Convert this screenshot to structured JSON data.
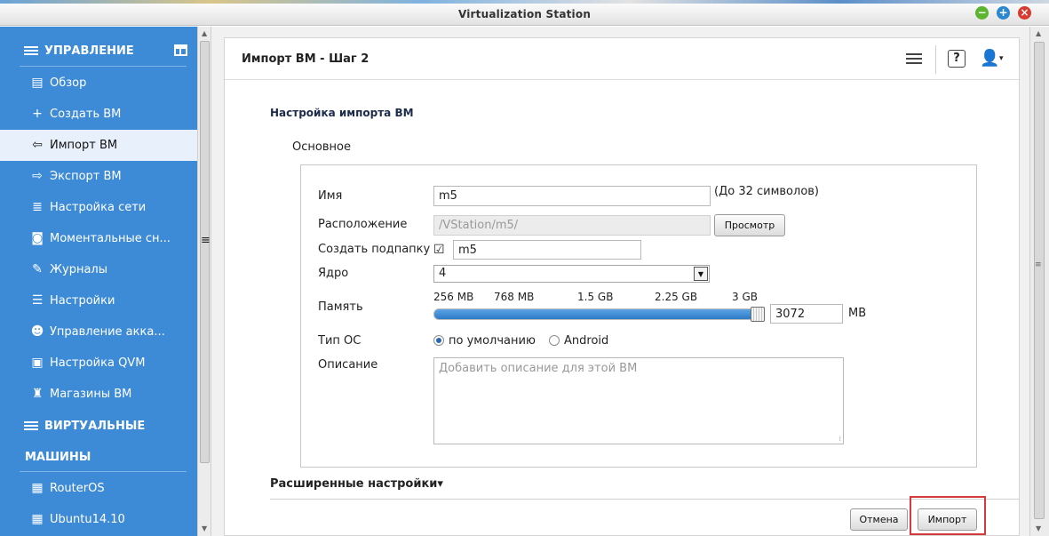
{
  "window": {
    "title": "Virtualization Station",
    "controls": {
      "minimize": "−",
      "maximize": "+",
      "close": "×"
    }
  },
  "sidebar": {
    "section_management": "УПРАВЛЕНИЕ",
    "items": [
      {
        "label": "Обзор",
        "icon": "overview-icon",
        "glyph": "▤"
      },
      {
        "label": "Создать ВМ",
        "icon": "plus-icon",
        "glyph": "+"
      },
      {
        "label": "Импорт ВМ",
        "icon": "import-icon",
        "glyph": "⇦",
        "active": true
      },
      {
        "label": "Экспорт ВМ",
        "icon": "export-icon",
        "glyph": "⇨"
      },
      {
        "label": "Настройка сети",
        "icon": "network-icon",
        "glyph": "≣"
      },
      {
        "label": "Моментальные сн...",
        "icon": "snapshot-icon",
        "glyph": "◙"
      },
      {
        "label": "Журналы",
        "icon": "logs-icon",
        "glyph": "✎"
      },
      {
        "label": "Настройки",
        "icon": "settings-icon",
        "glyph": "☰"
      },
      {
        "label": "Управление акка...",
        "icon": "accounts-icon",
        "glyph": "☻"
      },
      {
        "label": "Настройка QVM",
        "icon": "qvm-icon",
        "glyph": "▣"
      },
      {
        "label": "Магазины ВМ",
        "icon": "store-icon",
        "glyph": "♜"
      }
    ],
    "section_vms_line1": "ВИРТУАЛЬНЫЕ",
    "section_vms_line2": "МАШИНЫ",
    "vms": [
      {
        "label": "RouterOS",
        "icon": "vm-grid-icon",
        "glyph": "▦"
      },
      {
        "label": "Ubuntu14.10",
        "icon": "vm-grid-icon",
        "glyph": "▦"
      }
    ],
    "colors": {
      "background": "#3d8bd6",
      "active": "#e8f1fb"
    }
  },
  "panel": {
    "title": "Импорт ВМ - Шаг 2",
    "header_icons": [
      "list-icon",
      "help-icon",
      "user-menu-icon"
    ],
    "help_glyph": "?",
    "user_glyph": "👤",
    "caret_glyph": "▾"
  },
  "form": {
    "section_title": "Настройка импорта ВМ",
    "subsection": "Основное",
    "name_label": "Имя",
    "name_value": "m5",
    "name_hint": "(До 32 символов)",
    "location_label": "Расположение",
    "location_value": "/VStation/m5/",
    "browse_button": "Просмотр",
    "subfolder_label": "Создать подпапку",
    "subfolder_checked": true,
    "check_glyph": "☑",
    "subfolder_value": "m5",
    "core_label": "Ядро",
    "core_value": "4",
    "core_arrow": "▼",
    "memory_label": "Память",
    "memory_ticks": [
      "256 MB",
      "768 MB",
      "1.5 GB",
      "2.25 GB",
      "3 GB"
    ],
    "memory_value": "3072",
    "memory_unit": "MB",
    "memory_fraction": 1.0,
    "os_label": "Тип ОС",
    "os_options": [
      "по умолчанию",
      "Android"
    ],
    "os_selected": "по умолчанию",
    "description_label": "Описание",
    "description_placeholder": "Добавить описание для этой ВМ",
    "resize_glyph": "⁞"
  },
  "advanced_label": "Расширенные настройки▾",
  "buttons": {
    "cancel": "Отмена",
    "import": "Импорт"
  },
  "scroll": {
    "up": "▲",
    "down": "▼",
    "grip": "≡"
  },
  "colors": {
    "accent": "#3d8bd6",
    "slider": "#2d7bc6",
    "highlight": "#d63a3a"
  }
}
